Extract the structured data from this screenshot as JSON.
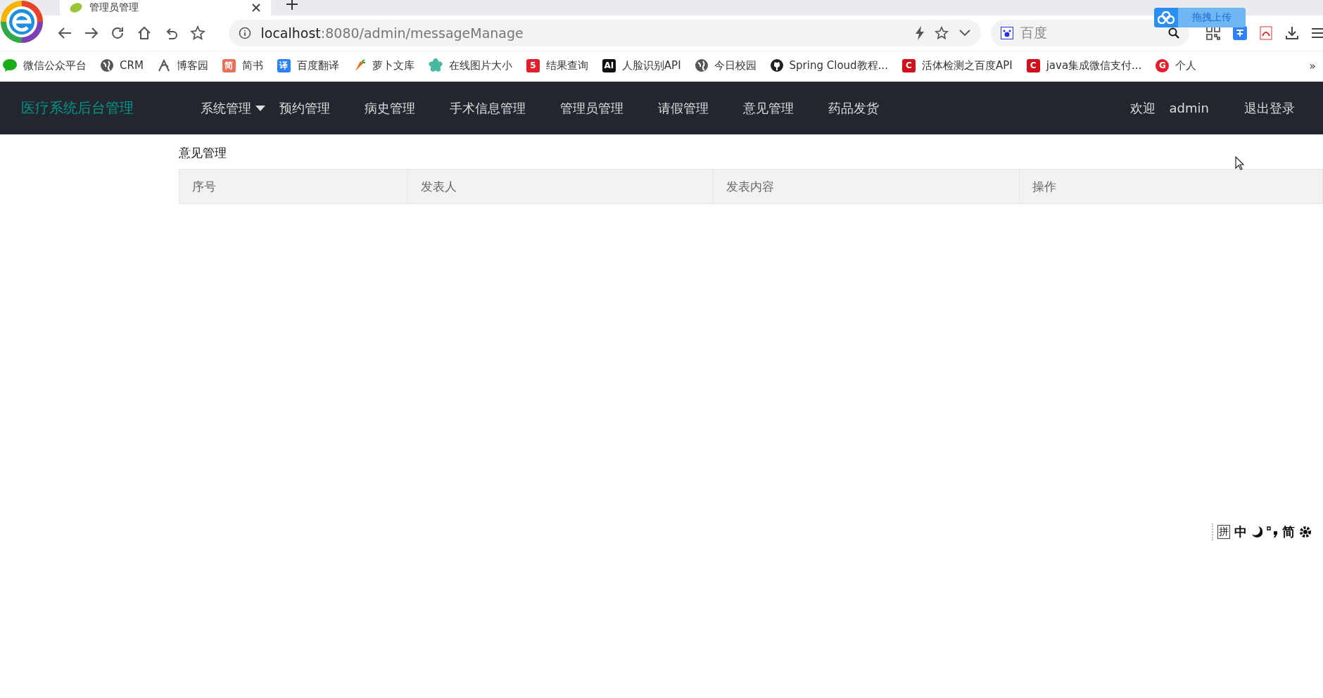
{
  "browser": {
    "tab_title": "管理员管理",
    "url_host": "localhost",
    "url_path": ":8080/admin/messageManage",
    "search_placeholder": "百度",
    "upload_button": "拖拽上传",
    "bookmarks": [
      {
        "label": "微信公众平台",
        "kind": "chat",
        "color": "#1aad19"
      },
      {
        "label": "CRM",
        "kind": "globe",
        "color": "#555555"
      },
      {
        "label": "博客园",
        "kind": "leaf",
        "color": "#555555"
      },
      {
        "label": "简书",
        "kind": "square",
        "color": "#ea6f5a",
        "glyph": "简"
      },
      {
        "label": "百度翻译",
        "kind": "square",
        "color": "#2e82f6",
        "glyph": "译"
      },
      {
        "label": "萝卜文库",
        "kind": "carrot",
        "color": "#e86a1a"
      },
      {
        "label": "在线图片大小",
        "kind": "flower",
        "color": "#48b8a0"
      },
      {
        "label": "结果查询",
        "kind": "square",
        "color": "#e0202a",
        "glyph": "5"
      },
      {
        "label": "人脸识别API",
        "kind": "square",
        "color": "#111111",
        "glyph": "AI"
      },
      {
        "label": "今日校园",
        "kind": "globe",
        "color": "#555555"
      },
      {
        "label": "Spring Cloud教程...",
        "kind": "github",
        "color": "#222222"
      },
      {
        "label": "活体检测之百度API",
        "kind": "square",
        "color": "#d0101a",
        "glyph": "C"
      },
      {
        "label": "java集成微信支付...",
        "kind": "square",
        "color": "#d0101a",
        "glyph": "C"
      },
      {
        "label": "个人",
        "kind": "circle",
        "color": "#e0202a",
        "glyph": "G"
      }
    ],
    "more": "»"
  },
  "app": {
    "brand": "医疗系统后台管理",
    "nav": [
      {
        "label": "系统管理",
        "dropdown": true
      },
      {
        "label": "预约管理",
        "dropdown": false
      },
      {
        "label": "病史管理",
        "dropdown": false
      },
      {
        "label": "手术信息管理",
        "dropdown": false
      },
      {
        "label": "管理员管理",
        "dropdown": false
      },
      {
        "label": "请假管理",
        "dropdown": false
      },
      {
        "label": "意见管理",
        "dropdown": false
      },
      {
        "label": "药品发货",
        "dropdown": false
      }
    ],
    "welcome": "欢迎",
    "user": "admin",
    "logout": "退出登录",
    "page_title": "意见管理",
    "table": {
      "columns": [
        "序号",
        "发表人",
        "发表内容",
        "操作"
      ]
    }
  },
  "ime_toolbar": {
    "items": [
      {
        "kind": "boxed",
        "text": "拼"
      },
      {
        "kind": "text",
        "text": "中"
      },
      {
        "kind": "moon"
      },
      {
        "kind": "punct"
      },
      {
        "kind": "text",
        "text": "简"
      },
      {
        "kind": "gear"
      }
    ]
  }
}
